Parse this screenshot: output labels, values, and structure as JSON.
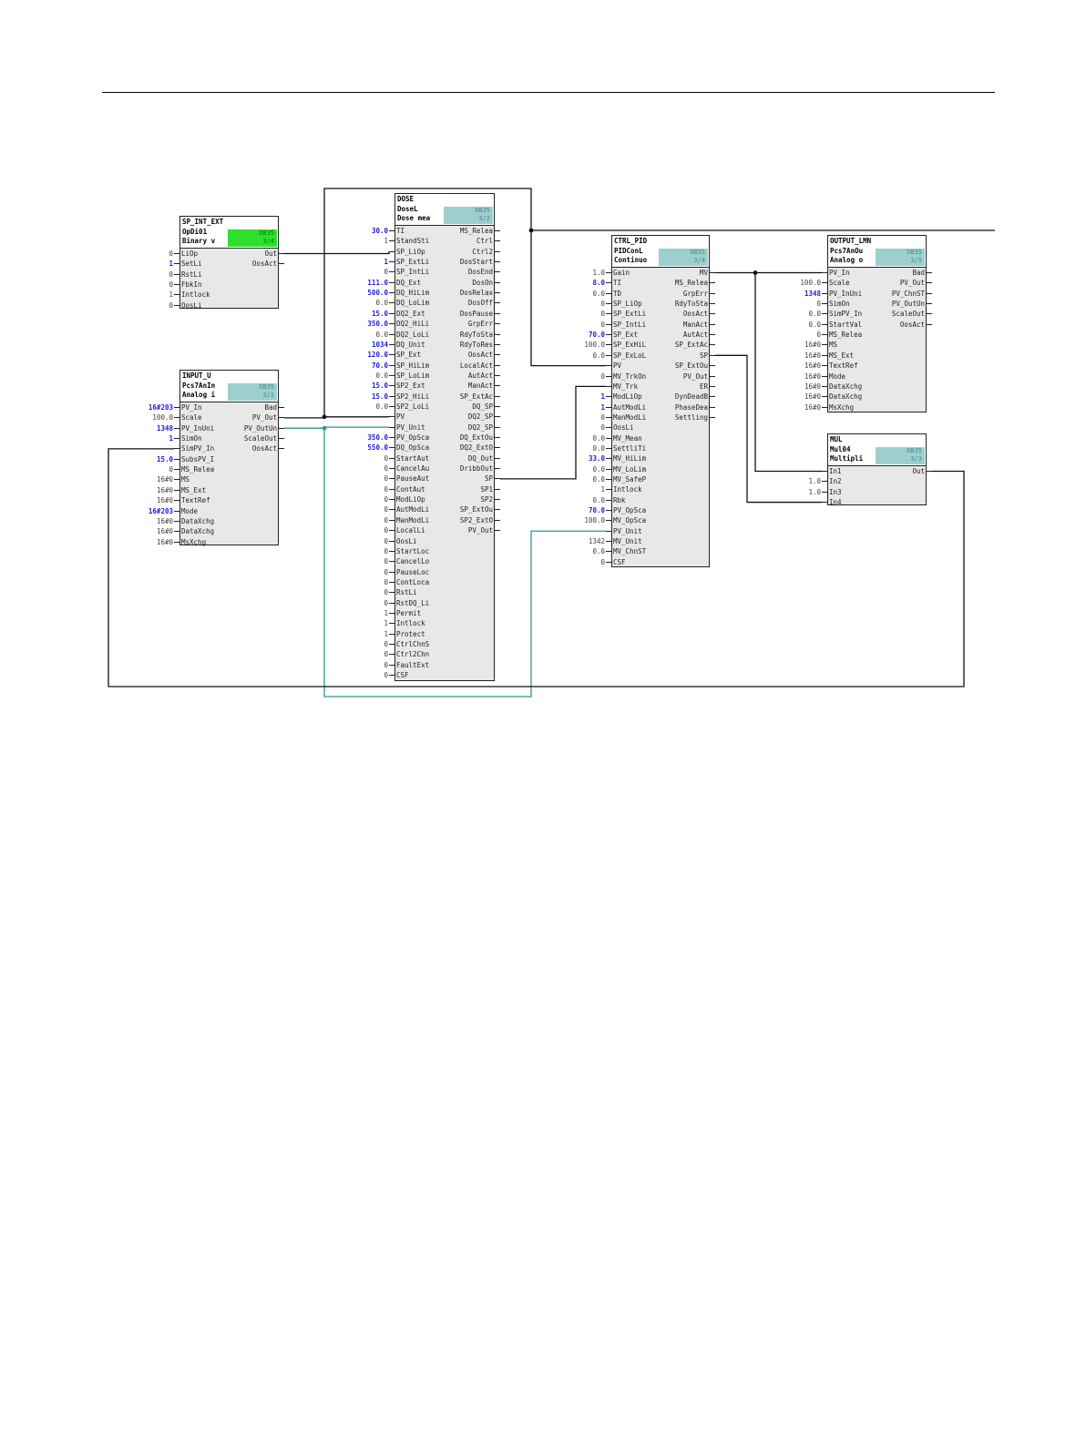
{
  "blocks": [
    {
      "id": "SP_INT_EXT",
      "title": "SP_INT_EXT",
      "type": "OpDi01",
      "desc": "Binary v",
      "badge": "OB35\n3/4",
      "badge_color": "green",
      "inputs": [
        {
          "name": "LiOp",
          "value": "0"
        },
        {
          "name": "SetLi",
          "value": "1",
          "blue": true
        },
        {
          "name": "RstLi",
          "value": "0"
        },
        {
          "name": "FbkIn",
          "value": "0"
        },
        {
          "name": "Intlock",
          "value": "1"
        },
        {
          "name": "OosLi",
          "value": "0"
        }
      ],
      "outputs": [
        {
          "name": "Out"
        },
        {
          "name": "OosAct"
        }
      ]
    },
    {
      "id": "INPUT_U",
      "title": "INPUT_U",
      "type": "Pcs7AnIn",
      "desc": "Analog i",
      "badge": "OB35\n3/1",
      "badge_color": "teal",
      "inputs": [
        {
          "name": "PV_In",
          "value": "16#203",
          "blue": true
        },
        {
          "name": "Scale",
          "value": "100.0"
        },
        {
          "name": "PV_InUni",
          "value": "1348",
          "blue": true
        },
        {
          "name": "SimOn",
          "value": "1",
          "blue": true
        },
        {
          "name": "SimPV_In",
          "value": ""
        },
        {
          "name": "SubsPV_I",
          "value": "15.0",
          "blue": true
        },
        {
          "name": "MS_Relea",
          "value": "0"
        },
        {
          "name": "MS",
          "value": "16#0"
        },
        {
          "name": "MS_Ext",
          "value": "16#0"
        },
        {
          "name": "TextRef",
          "value": "16#0"
        },
        {
          "name": "Mode",
          "value": "16#203",
          "blue": true
        },
        {
          "name": "DataXchg",
          "value": "16#0"
        },
        {
          "name": "DataXchg",
          "value": "16#0"
        },
        {
          "name": "MsXchg",
          "value": "16#0"
        }
      ],
      "outputs": [
        {
          "name": "Bad"
        },
        {
          "name": "PV_Out"
        },
        {
          "name": "PV_OutUn"
        },
        {
          "name": "ScaleOut"
        },
        {
          "name": "OosAct"
        }
      ]
    },
    {
      "id": "DOSE",
      "title": "DOSE",
      "type": "DoseL",
      "desc": "Dose mea",
      "badge": "OB35\n3/2",
      "badge_color": "teal",
      "inputs": [
        {
          "name": "TI",
          "value": "30.0",
          "blue": true
        },
        {
          "name": "StandSti",
          "value": "1"
        },
        {
          "name": "SP_LiOp",
          "value": ""
        },
        {
          "name": "SP_ExtLi",
          "value": "1",
          "blue": true
        },
        {
          "name": "SP_IntLi",
          "value": "0"
        },
        {
          "name": "DQ_Ext",
          "value": "111.0",
          "blue": true
        },
        {
          "name": "DQ_HiLim",
          "value": "500.0",
          "blue": true
        },
        {
          "name": "DQ_LoLim",
          "value": "0.0"
        },
        {
          "name": "DQ2_Ext",
          "value": "15.0",
          "blue": true
        },
        {
          "name": "DQ2_HiLi",
          "value": "350.0",
          "blue": true
        },
        {
          "name": "DQ2_LoLi",
          "value": "0.0"
        },
        {
          "name": "DQ_Unit",
          "value": "1034",
          "blue": true
        },
        {
          "name": "SP_Ext",
          "value": "120.0",
          "blue": true
        },
        {
          "name": "SP_HiLim",
          "value": "70.0",
          "blue": true
        },
        {
          "name": "SP_LoLim",
          "value": "0.0"
        },
        {
          "name": "SP2_Ext",
          "value": "15.0",
          "blue": true
        },
        {
          "name": "SP2_HiLi",
          "value": "15.0",
          "blue": true
        },
        {
          "name": "SP2_LoLi",
          "value": "0.0"
        },
        {
          "name": "PV",
          "value": ""
        },
        {
          "name": "PV_Unit",
          "value": ""
        },
        {
          "name": "PV_OpSca",
          "value": "350.0",
          "blue": true
        },
        {
          "name": "DQ_OpSca",
          "value": "550.0",
          "blue": true
        },
        {
          "name": "StartAut",
          "value": "0"
        },
        {
          "name": "CancelAu",
          "value": "0"
        },
        {
          "name": "PauseAut",
          "value": "0"
        },
        {
          "name": "ContAut",
          "value": "0"
        },
        {
          "name": "ModLiOp",
          "value": "0"
        },
        {
          "name": "AutModLi",
          "value": "0"
        },
        {
          "name": "ManModLi",
          "value": "0"
        },
        {
          "name": "LocalLi",
          "value": "0"
        },
        {
          "name": "OosLi",
          "value": "0"
        },
        {
          "name": "StartLoc",
          "value": "0"
        },
        {
          "name": "CancelLo",
          "value": "0"
        },
        {
          "name": "PauseLoc",
          "value": "0"
        },
        {
          "name": "ContLoca",
          "value": "0"
        },
        {
          "name": "RstLi",
          "value": "0"
        },
        {
          "name": "RstDQ_Li",
          "value": "0"
        },
        {
          "name": "Permit",
          "value": "1"
        },
        {
          "name": "Intlock",
          "value": "1"
        },
        {
          "name": "Protect",
          "value": "1"
        },
        {
          "name": "CtrlChnS",
          "value": "0"
        },
        {
          "name": "Ctrl2Chn",
          "value": "0"
        },
        {
          "name": "FaultExt",
          "value": "0"
        },
        {
          "name": "CSF",
          "value": "0"
        }
      ],
      "outputs": [
        {
          "name": "MS_Relea"
        },
        {
          "name": "Ctrl"
        },
        {
          "name": "Ctrl2"
        },
        {
          "name": "DosStart"
        },
        {
          "name": "DosEnd"
        },
        {
          "name": "DosOn"
        },
        {
          "name": "DosRelax"
        },
        {
          "name": "DosOff"
        },
        {
          "name": "DosPause"
        },
        {
          "name": "GrpErr"
        },
        {
          "name": "RdyToSta"
        },
        {
          "name": "RdyToRes"
        },
        {
          "name": "OosAct"
        },
        {
          "name": "LocalAct"
        },
        {
          "name": "AutAct"
        },
        {
          "name": "ManAct"
        },
        {
          "name": "SP_ExtAc"
        },
        {
          "name": "DQ_SP"
        },
        {
          "name": "DQ2_SP"
        },
        {
          "name": "DQ2_SP"
        },
        {
          "name": "DQ_ExtOu"
        },
        {
          "name": "DQ2_ExtO"
        },
        {
          "name": "DQ_Out"
        },
        {
          "name": "DribbOut"
        },
        {
          "name": "SP"
        },
        {
          "name": "SP1"
        },
        {
          "name": "SP2"
        },
        {
          "name": "SP_ExtOu"
        },
        {
          "name": "SP2_ExtO"
        },
        {
          "name": "PV_Out"
        }
      ]
    },
    {
      "id": "CTRL_PID",
      "title": "CTRL_PID",
      "type": "PIDConL",
      "desc": "Continuo",
      "badge": "OB35\n3/4",
      "badge_color": "teal",
      "inputs": [
        {
          "name": "Gain",
          "value": "1.0"
        },
        {
          "name": "TI",
          "value": "8.0",
          "blue": true
        },
        {
          "name": "TD",
          "value": "0.0"
        },
        {
          "name": "SP_LiOp",
          "value": "0"
        },
        {
          "name": "SP_ExtLi",
          "value": "0"
        },
        {
          "name": "SP_IntLi",
          "value": "0"
        },
        {
          "name": "SP_Ext",
          "value": "70.0",
          "blue": true
        },
        {
          "name": "SP_ExHiL",
          "value": "100.0"
        },
        {
          "name": "SP_ExLoL",
          "value": "0.0"
        },
        {
          "name": "PV",
          "value": ""
        },
        {
          "name": "MV_TrkOn",
          "value": "0"
        },
        {
          "name": "MV_Trk",
          "value": ""
        },
        {
          "name": "ModLiOp",
          "value": "1",
          "blue": true
        },
        {
          "name": "AutModLi",
          "value": "1",
          "blue": true
        },
        {
          "name": "ManModLi",
          "value": "0"
        },
        {
          "name": "OosLi",
          "value": "0"
        },
        {
          "name": "MV_Mean",
          "value": "0.0"
        },
        {
          "name": "SettliTi",
          "value": "0.0"
        },
        {
          "name": "MV_HiLim",
          "value": "33.0",
          "blue": true
        },
        {
          "name": "MV_LoLim",
          "value": "0.0"
        },
        {
          "name": "MV_SafeP",
          "value": "0.0"
        },
        {
          "name": "Intlock",
          "value": "1"
        },
        {
          "name": "Rbk",
          "value": "0.0"
        },
        {
          "name": "PV_OpSca",
          "value": "70.0",
          "blue": true
        },
        {
          "name": "MV_OpSca",
          "value": "100.0"
        },
        {
          "name": "PV_Unit",
          "value": ""
        },
        {
          "name": "MV_Unit",
          "value": "1342"
        },
        {
          "name": "MV_ChnST",
          "value": "0.0"
        },
        {
          "name": "CSF",
          "value": "0"
        }
      ],
      "outputs": [
        {
          "name": "MV"
        },
        {
          "name": "MS_Relea"
        },
        {
          "name": "GrpErr"
        },
        {
          "name": "RdyToSta"
        },
        {
          "name": "OosAct"
        },
        {
          "name": "ManAct"
        },
        {
          "name": "AutAct"
        },
        {
          "name": "SP_ExtAc"
        },
        {
          "name": "SP"
        },
        {
          "name": "SP_ExtOu"
        },
        {
          "name": "PV_Out"
        },
        {
          "name": "ER"
        },
        {
          "name": "DynDeadB"
        },
        {
          "name": "PhaseDea"
        },
        {
          "name": "Settling"
        }
      ]
    },
    {
      "id": "OUTPUT_LMN",
      "title": "OUTPUT_LMN",
      "type": "Pcs7AnOu",
      "desc": "Analog o",
      "badge": "OB35\n3/5",
      "badge_color": "teal",
      "inputs": [
        {
          "name": "PV_In",
          "value": ""
        },
        {
          "name": "Scale",
          "value": "100.0"
        },
        {
          "name": "PV_InUni",
          "value": "1348",
          "blue": true
        },
        {
          "name": "SimOn",
          "value": "0"
        },
        {
          "name": "SimPV_In",
          "value": "0.0"
        },
        {
          "name": "StartVal",
          "value": "0.0"
        },
        {
          "name": "MS_Relea",
          "value": "0"
        },
        {
          "name": "MS",
          "value": "16#0"
        },
        {
          "name": "MS_Ext",
          "value": "16#0"
        },
        {
          "name": "TextRef",
          "value": "16#0"
        },
        {
          "name": "Mode",
          "value": "16#0"
        },
        {
          "name": "DataXchg",
          "value": "16#0"
        },
        {
          "name": "DataXchg",
          "value": "16#0"
        },
        {
          "name": "MsXchg",
          "value": "16#0"
        }
      ],
      "outputs": [
        {
          "name": "Bad"
        },
        {
          "name": "PV_Out"
        },
        {
          "name": "PV_ChnST"
        },
        {
          "name": "PV_OutUn"
        },
        {
          "name": "ScaleOut"
        },
        {
          "name": "OosAct"
        }
      ]
    },
    {
      "id": "MUL",
      "title": "MUL",
      "type": "Mul04",
      "desc": "Multipli",
      "badge": "OB35\n3/3",
      "badge_color": "teal",
      "inputs": [
        {
          "name": "In1",
          "value": ""
        },
        {
          "name": "In2",
          "value": "1.0"
        },
        {
          "name": "In3",
          "value": "1.0"
        },
        {
          "name": "In4",
          "value": ""
        }
      ],
      "outputs": [
        {
          "name": "Out"
        }
      ]
    }
  ]
}
